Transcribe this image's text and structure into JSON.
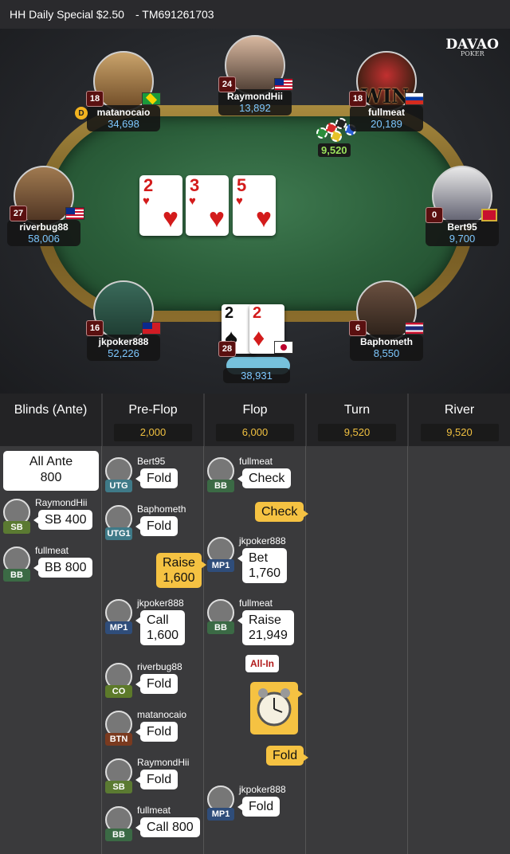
{
  "header": {
    "title": "HH  Daily Special $2.50",
    "id": "- TM691261703"
  },
  "brand": {
    "name": "DAVAO",
    "sub": "POKER"
  },
  "felt_logo": "O",
  "pot": {
    "amount": "9,520"
  },
  "board": [
    {
      "rank": "2",
      "suit": "♥"
    },
    {
      "rank": "3",
      "suit": "♥"
    },
    {
      "rank": "5",
      "suit": "♥"
    }
  ],
  "seats": [
    {
      "name": "matanocaio",
      "stack": "34,698",
      "level": "18"
    },
    {
      "name": "RaymondHii",
      "stack": "13,892",
      "level": "24"
    },
    {
      "name": "fullmeat",
      "stack": "20,189",
      "level": "18"
    },
    {
      "name": "riverbug88",
      "stack": "58,006",
      "level": "27"
    },
    {
      "name": "Bert95",
      "stack": "9,700",
      "level": "0"
    },
    {
      "name": "jkpoker888",
      "stack": "52,226",
      "level": "16"
    },
    {
      "name": "Baphometh",
      "stack": "8,550",
      "level": "6"
    }
  ],
  "dealer": "D",
  "win_text": "WIN",
  "hero": {
    "level": "28",
    "stack": "38,931",
    "cards": [
      {
        "rank": "2",
        "suit": "♠"
      },
      {
        "rank": "2",
        "suit": "♦"
      }
    ]
  },
  "columns": [
    {
      "title": "Blinds (Ante)",
      "amount": ""
    },
    {
      "title": "Pre-Flop",
      "amount": "2,000"
    },
    {
      "title": "Flop",
      "amount": "6,000"
    },
    {
      "title": "Turn",
      "amount": "9,520"
    },
    {
      "title": "River",
      "amount": "9,520"
    }
  ],
  "ante": {
    "label": "All Ante",
    "value": "800"
  },
  "blinds": [
    {
      "name": "RaymondHii",
      "pos": "SB",
      "action": "SB 400"
    },
    {
      "name": "fullmeat",
      "pos": "BB",
      "action": "BB 800"
    }
  ],
  "preflop": [
    {
      "name": "Bert95",
      "pos": "UTG",
      "action": "Fold"
    },
    {
      "name": "Baphometh",
      "pos": "UTG1",
      "action": "Fold"
    },
    {
      "hero_action": "Raise\n1,600"
    },
    {
      "name": "jkpoker888",
      "pos": "MP1",
      "action": "Call\n1,600"
    },
    {
      "name": "riverbug88",
      "pos": "CO",
      "action": "Fold"
    },
    {
      "name": "matanocaio",
      "pos": "BTN",
      "action": "Fold"
    },
    {
      "name": "RaymondHii",
      "pos": "SB",
      "action": "Fold"
    },
    {
      "name": "fullmeat",
      "pos": "BB",
      "action": "Call 800"
    }
  ],
  "flop": [
    {
      "name": "fullmeat",
      "pos": "BB",
      "action": "Check"
    },
    {
      "hero_action": "Check"
    },
    {
      "name": "jkpoker888",
      "pos": "MP1",
      "action": "Bet\n1,760"
    },
    {
      "name": "fullmeat",
      "pos": "BB",
      "action": "Raise\n21,949"
    },
    {
      "badge": "All-In"
    },
    {
      "hero_action": "Fold"
    },
    {
      "name": "jkpoker888",
      "pos": "MP1",
      "action": "Fold"
    }
  ],
  "colors": {
    "pos_utg": "#3f7a88",
    "pos_mp": "#2f4d7a",
    "pos_co": "#5d7a2a",
    "pos_btn": "#7a3a1f",
    "pos_sb": "#5b7a32",
    "pos_bb": "#3b6a45",
    "pos_utg1": "#3f7a88",
    "accent": "#f5c242"
  }
}
